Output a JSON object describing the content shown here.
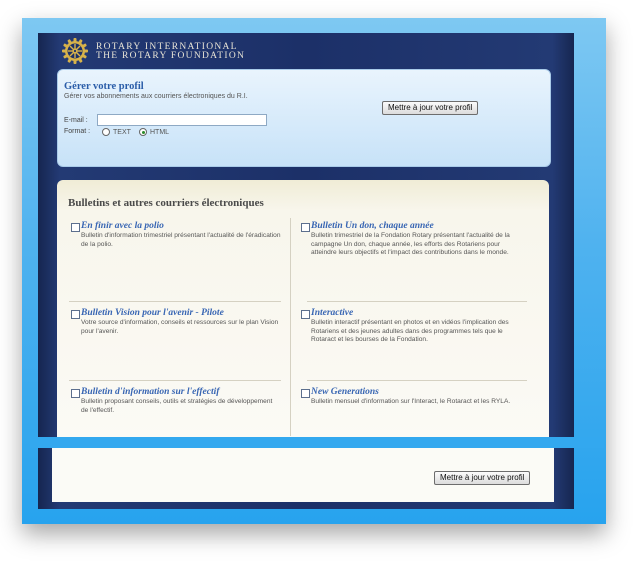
{
  "logo": {
    "line1": "ROTARY INTERNATIONAL",
    "line2": "THE ROTARY FOUNDATION",
    "icon": "rotary-wheel-icon"
  },
  "profile": {
    "title": "Gérer votre profil",
    "subtitle": "Gérer vos abonnements aux courriers électroniques du R.I.",
    "update_button": "Mettre à jour votre profil",
    "email_label": "E-mail :",
    "email_value": "",
    "format_label": "Format :",
    "format_options": [
      "TEXT",
      "HTML"
    ],
    "format_selected": "HTML"
  },
  "bulletins": {
    "title": "Bulletins et autres courriers électroniques",
    "items": [
      {
        "title": "En finir avec la polio",
        "desc": "Bulletin d'information trimestriel présentant l'actualité de l'éradication de la polio."
      },
      {
        "title": "Bulletin Un don, chaque année",
        "desc": "Bulletin trimestriel de la Fondation Rotary présentant l'actualité de la campagne Un don, chaque année, les efforts des Rotariens pour atteindre leurs objectifs et l'impact des contributions dans le monde."
      },
      {
        "title": "Bulletin Vision pour l'avenir - Pilote",
        "desc": "Votre source d'information, conseils et ressources sur le plan Vision pour l'avenir."
      },
      {
        "title": "Interactive",
        "desc": "Bulletin interactif présentant en photos et en vidéos l'implication des Rotariens et des jeunes adultes dans des programmes tels que le Rotaract et les bourses de la Fondation."
      },
      {
        "title": "Bulletin d'information sur l'effectif",
        "desc": "Bulletin proposant conseils, outils et stratégies de développement de l'effectif."
      },
      {
        "title": "New Generations",
        "desc": "Bulletin mensuel d'information sur l'Interact, le Rotaract et les RYLA."
      }
    ]
  },
  "footer": {
    "update_button": "Mettre à jour votre profil"
  },
  "colors": {
    "frame_blue": "#27a3ee",
    "site_navy": "#1c3068",
    "link_blue": "#3765b3",
    "profile_bg": "#c7e2f8",
    "bulletin_bg": "#fbfaf5"
  }
}
